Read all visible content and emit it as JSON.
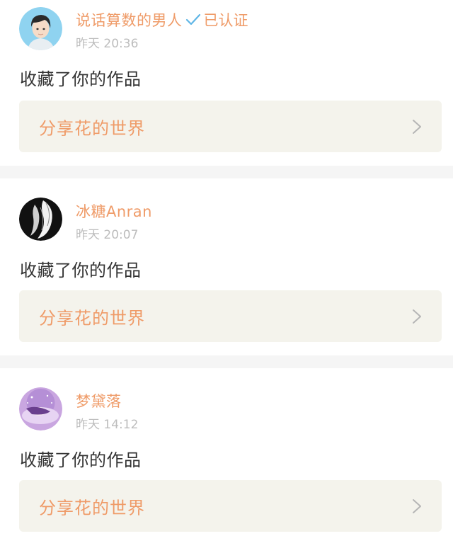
{
  "notifications": [
    {
      "username": "说话算数的男人",
      "verified": true,
      "verified_label": "已认证",
      "timestamp": "昨天 20:36",
      "action": "收藏了你的作品",
      "work_title": "分享花的世界",
      "avatar_icon": "cartoon-boy-avatar"
    },
    {
      "username": "冰糖Anran",
      "verified": false,
      "timestamp": "昨天 20:07",
      "action": "收藏了你的作品",
      "work_title": "分享花的世界",
      "avatar_icon": "black-white-sketch-avatar"
    },
    {
      "username": "梦黛落",
      "verified": false,
      "timestamp": "昨天 14:12",
      "action": "收藏了你的作品",
      "work_title": "分享花的世界",
      "avatar_icon": "purple-anime-avatar"
    }
  ],
  "colors": {
    "accent": "#ef9b68",
    "verified_check": "#5fb6e6",
    "link_background": "#f4f3ec",
    "divider": "#f5f5f5",
    "timestamp": "#bdbdbd",
    "body_text": "#333333"
  }
}
